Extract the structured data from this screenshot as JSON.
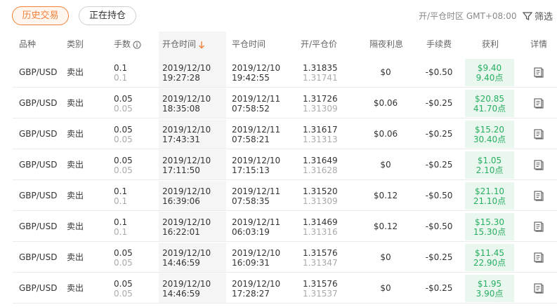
{
  "tabs": {
    "history": "历史交易",
    "open": "正在持仓"
  },
  "timezone": "开/平仓时区 GMT+08:00",
  "filter_label": "筛选",
  "headers": {
    "symbol": "品种",
    "type": "类别",
    "lots": "手数",
    "open_time": "开仓时间",
    "close_time": "平仓时间",
    "price": "开/平仓价",
    "swap": "隔夜利息",
    "fee": "手续费",
    "profit": "获利",
    "detail": "详情"
  },
  "colors": {
    "accent": "#f0813a",
    "profit_text": "#27ae60",
    "profit_bg": "#e9f7ef"
  },
  "rows": [
    {
      "symbol": "GBP/USD",
      "type": "卖出",
      "lots": "0.1",
      "lots2": "0.1",
      "open_date": "2019/12/10",
      "open_time": "19:27:28",
      "close_date": "2019/12/10",
      "close_time": "19:42:55",
      "open_price": "1.31835",
      "close_price": "1.31741",
      "swap": "$0",
      "fee": "-$0.50",
      "profit": "$9.40",
      "points": "9.40点"
    },
    {
      "symbol": "GBP/USD",
      "type": "卖出",
      "lots": "0.05",
      "lots2": "0.05",
      "open_date": "2019/12/10",
      "open_time": "18:35:08",
      "close_date": "2019/12/11",
      "close_time": "07:58:52",
      "open_price": "1.31726",
      "close_price": "1.31309",
      "swap": "$0.06",
      "fee": "-$0.25",
      "profit": "$20.85",
      "points": "41.70点"
    },
    {
      "symbol": "GBP/USD",
      "type": "卖出",
      "lots": "0.05",
      "lots2": "0.05",
      "open_date": "2019/12/10",
      "open_time": "17:43:31",
      "close_date": "2019/12/11",
      "close_time": "07:58:21",
      "open_price": "1.31617",
      "close_price": "1.31313",
      "swap": "$0.06",
      "fee": "-$0.25",
      "profit": "$15.20",
      "points": "30.40点"
    },
    {
      "symbol": "GBP/USD",
      "type": "卖出",
      "lots": "0.05",
      "lots2": "0.05",
      "open_date": "2019/12/10",
      "open_time": "17:11:50",
      "close_date": "2019/12/10",
      "close_time": "17:15:13",
      "open_price": "1.31649",
      "close_price": "1.31628",
      "swap": "$0",
      "fee": "-$0.25",
      "profit": "$1.05",
      "points": "2.10点"
    },
    {
      "symbol": "GBP/USD",
      "type": "卖出",
      "lots": "0.1",
      "lots2": "0.1",
      "open_date": "2019/12/10",
      "open_time": "16:39:06",
      "close_date": "2019/12/11",
      "close_time": "07:58:35",
      "open_price": "1.31520",
      "close_price": "1.31309",
      "swap": "$0.12",
      "fee": "-$0.50",
      "profit": "$21.10",
      "points": "21.10点"
    },
    {
      "symbol": "GBP/USD",
      "type": "卖出",
      "lots": "0.1",
      "lots2": "0.1",
      "open_date": "2019/12/10",
      "open_time": "16:22:01",
      "close_date": "2019/12/11",
      "close_time": "06:03:19",
      "open_price": "1.31469",
      "close_price": "1.31316",
      "swap": "$0.12",
      "fee": "-$0.50",
      "profit": "$15.30",
      "points": "15.30点"
    },
    {
      "symbol": "GBP/USD",
      "type": "卖出",
      "lots": "0.05",
      "lots2": "0.05",
      "open_date": "2019/12/10",
      "open_time": "14:46:59",
      "close_date": "2019/12/10",
      "close_time": "16:09:31",
      "open_price": "1.31576",
      "close_price": "1.31347",
      "swap": "$0",
      "fee": "-$0.25",
      "profit": "$11.45",
      "points": "22.90点"
    },
    {
      "symbol": "GBP/USD",
      "type": "卖出",
      "lots": "0.05",
      "lots2": "0.05",
      "open_date": "2019/12/10",
      "open_time": "14:46:59",
      "close_date": "2019/12/10",
      "close_time": "17:28:27",
      "open_price": "1.31576",
      "close_price": "1.31537",
      "swap": "$0",
      "fee": "-$0.25",
      "profit": "$1.95",
      "points": "3.90点"
    }
  ]
}
